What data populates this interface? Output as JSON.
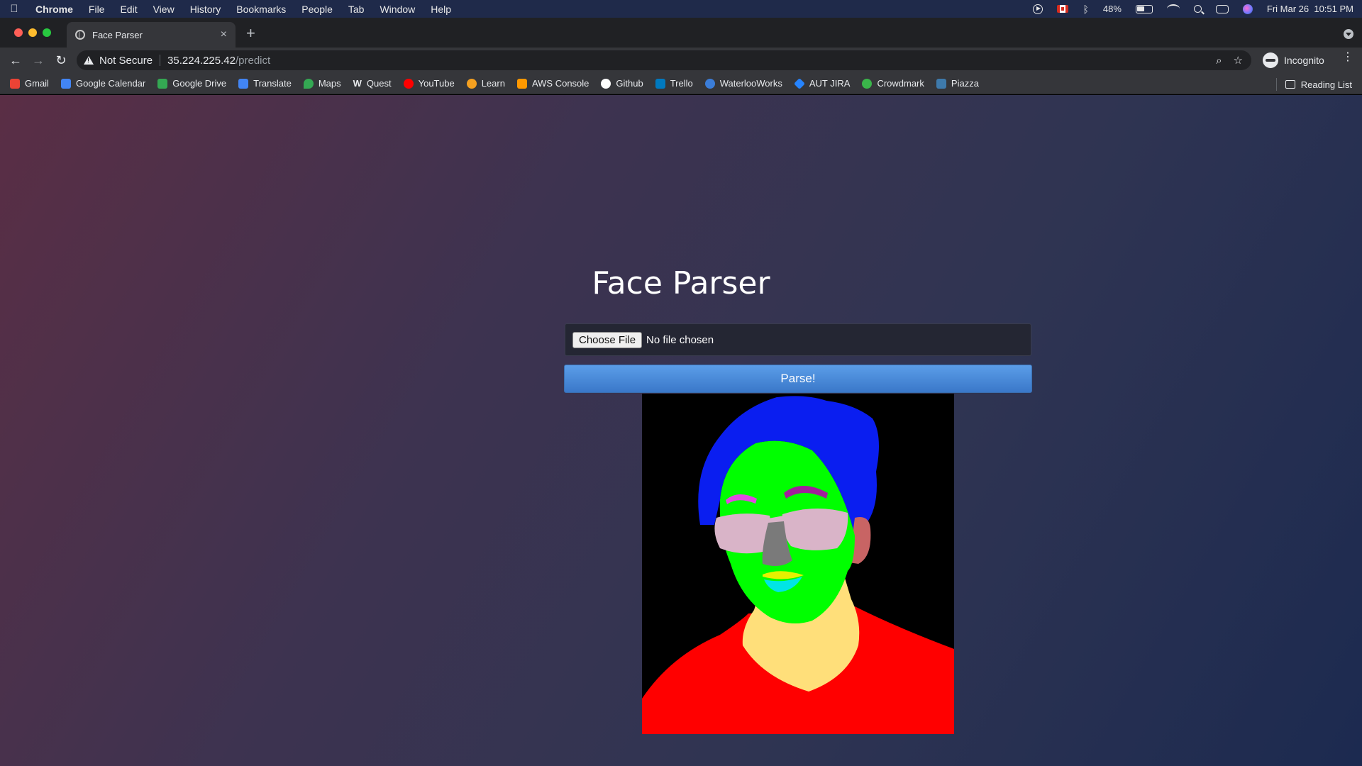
{
  "menubar": {
    "app": "Chrome",
    "items": [
      "File",
      "Edit",
      "View",
      "History",
      "Bookmarks",
      "People",
      "Tab",
      "Window",
      "Help"
    ],
    "battery": "48%",
    "datetime": "Fri Mar 26  10:51 PM"
  },
  "tab": {
    "title": "Face Parser",
    "close": "×",
    "new": "+"
  },
  "toolbar": {
    "security": "Not Secure",
    "url_host": "35.224.225.42",
    "url_path": "/predict",
    "profile": "Incognito"
  },
  "bookmarks": [
    {
      "label": "Gmail",
      "color": "#ea4335"
    },
    {
      "label": "Google Calendar",
      "color": "#4285f4"
    },
    {
      "label": "Google Drive",
      "color": "#34a853"
    },
    {
      "label": "Translate",
      "color": "#4285f4"
    },
    {
      "label": "Maps",
      "color": "#34a853"
    },
    {
      "label": "Quest",
      "color": "#111111"
    },
    {
      "label": "YouTube",
      "color": "#ff0000"
    },
    {
      "label": "Learn",
      "color": "#f4a020"
    },
    {
      "label": "AWS Console",
      "color": "#ff9900"
    },
    {
      "label": "Github",
      "color": "#ffffff"
    },
    {
      "label": "Trello",
      "color": "#0079bf"
    },
    {
      "label": "WaterlooWorks",
      "color": "#3b7dd8"
    },
    {
      "label": "AUT JIRA",
      "color": "#2684ff"
    },
    {
      "label": "Crowdmark",
      "color": "#3ab54a"
    },
    {
      "label": "Piazza",
      "color": "#3e7aab"
    }
  ],
  "reading_list": "Reading List",
  "page": {
    "title": "Face Parser",
    "file_button": "Choose File",
    "file_status": "No file chosen",
    "submit": "Parse!"
  },
  "segmentation_colors": {
    "background": "#000000",
    "hair": "#0a1ef0",
    "skin": "#00ff00",
    "brows": "#a0209a",
    "glasses": "#d9b4c8",
    "nose": "#7a7a7a",
    "lips": "#e6f000",
    "mouth": "#00e5e5",
    "neck": "#ffdf7a",
    "ear": "#c86464",
    "cloth": "#ff0000"
  }
}
